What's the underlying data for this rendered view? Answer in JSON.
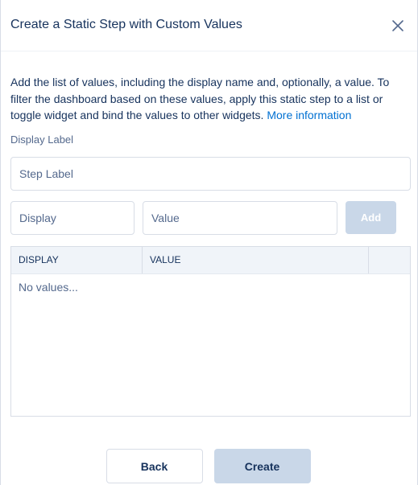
{
  "modal": {
    "title": "Create a Static Step with Custom Values",
    "close_icon": "close-icon"
  },
  "body": {
    "description": "Add the list of values, including the display name and, optionally, a value. To filter the dashboard based on these values, apply this static step to a list or toggle widget and bind the values to other widgets.",
    "more_link": "More information",
    "display_label": "Display Label",
    "step_label_placeholder": "Step Label",
    "display_placeholder": "Display",
    "value_placeholder": "Value",
    "add_label": "Add"
  },
  "table": {
    "columns": [
      "DISPLAY",
      "VALUE",
      ""
    ],
    "empty_text": "No values..."
  },
  "footer": {
    "back_label": "Back",
    "create_label": "Create"
  },
  "colors": {
    "link": "#0070d2",
    "disabled_button": "#c9d7e8",
    "text": "#16325c",
    "muted": "#54698d"
  }
}
